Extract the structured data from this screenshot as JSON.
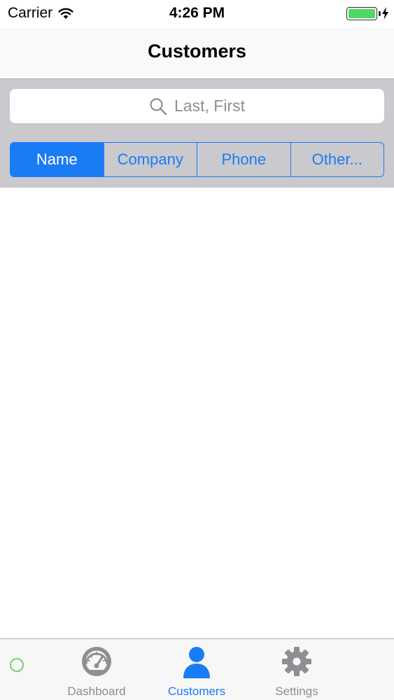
{
  "status_bar": {
    "carrier": "Carrier",
    "time": "4:26 PM",
    "battery_level": 1.0,
    "battery_color": "#4cd964",
    "icons": [
      "wifi-icon",
      "battery-icon",
      "charging-bolt-icon"
    ]
  },
  "nav": {
    "title": "Customers"
  },
  "search": {
    "placeholder": "Last, First",
    "icon": "search-icon"
  },
  "segments": {
    "items": [
      {
        "label": "Name",
        "selected": true
      },
      {
        "label": "Company",
        "selected": false
      },
      {
        "label": "Phone",
        "selected": false
      },
      {
        "label": "Other...",
        "selected": false
      }
    ]
  },
  "tab_bar": {
    "items": [
      {
        "label": "Dashboard",
        "icon": "gauge-icon",
        "active": false
      },
      {
        "label": "Customers",
        "icon": "person-icon",
        "active": true
      },
      {
        "label": "Settings",
        "icon": "gear-icon",
        "active": false
      }
    ],
    "activity_indicator_color": "#6fd36f"
  },
  "colors": {
    "accent": "#1a7cf5",
    "inactive": "#8e8e93",
    "search_background": "#c9c9ce"
  }
}
